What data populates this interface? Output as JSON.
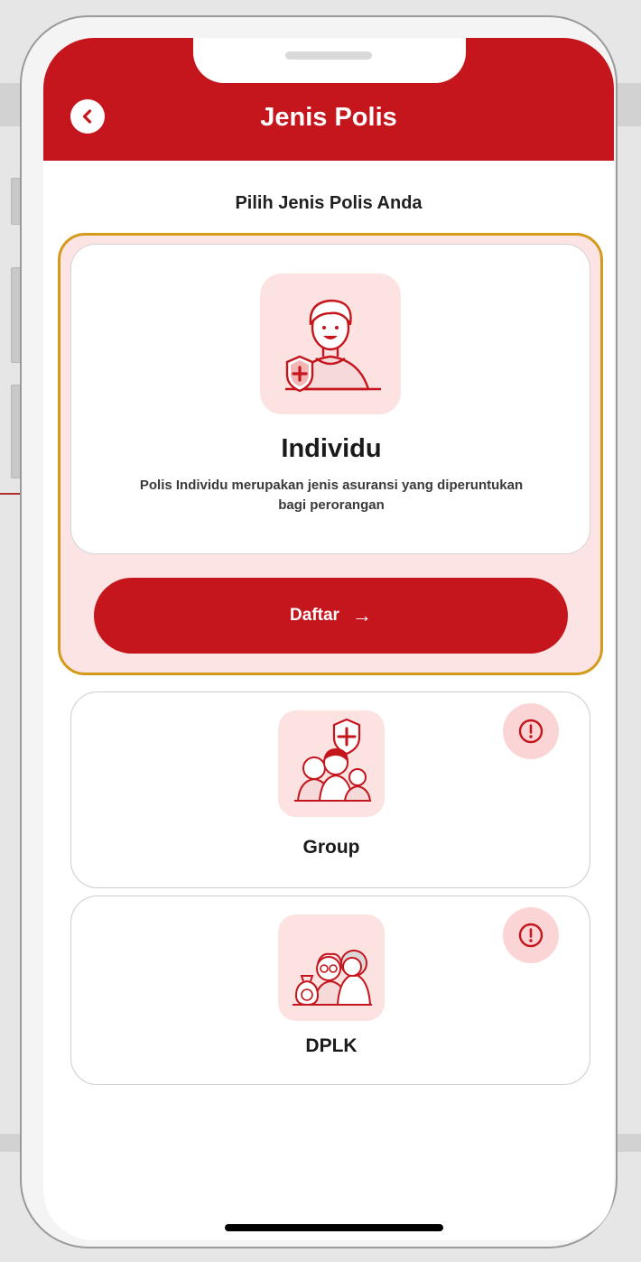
{
  "header": {
    "title": "Jenis Polis"
  },
  "page": {
    "subtitle": "Pilih Jenis Polis Anda"
  },
  "selected_card": {
    "title": "Individu",
    "description": "Polis Individu merupakan jenis asuransi yang diperuntukan bagi perorangan",
    "button_label": "Daftar",
    "button_arrow": "→"
  },
  "cards": [
    {
      "label": "Group"
    },
    {
      "label": "DPLK"
    }
  ],
  "colors": {
    "brand": "#c4161c",
    "selection_border": "#d49a1c",
    "selected_background": "#fde4e4",
    "illustration_background": "#fde2e2"
  },
  "icons": {
    "back": "chevron-left-circle-icon",
    "individu": "person-shield-illustration-icon",
    "group": "family-shield-illustration-icon",
    "dplk": "elderly-couple-money-bag-illustration-icon",
    "info": "exclamation-circle-icon"
  }
}
